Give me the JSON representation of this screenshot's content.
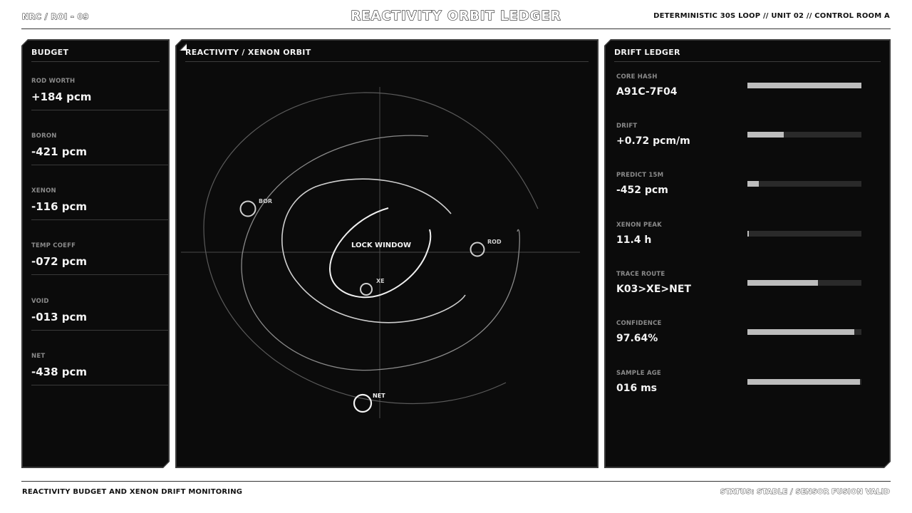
{
  "header": {
    "left": "NRC / ROI - 09",
    "title": "REACTIVITY ORBIT LEDGER",
    "right": "DETERMINISTIC 30S LOOP  //  UNIT 02  //  CONTROL ROOM A"
  },
  "footer": {
    "left": "REACTIVITY BUDGET AND XENON DRIFT MONITORING",
    "right": "STATUS: STABLE / SENSOR FUSION VALID"
  },
  "budget": {
    "title": "BUDGET",
    "items": [
      {
        "label": "ROD WORTH",
        "value": "+184 pcm"
      },
      {
        "label": "BORON",
        "value": "-421 pcm"
      },
      {
        "label": "XENON",
        "value": "-116 pcm"
      },
      {
        "label": "TEMP COEFF",
        "value": "-072 pcm"
      },
      {
        "label": "VOID",
        "value": "-013 pcm"
      },
      {
        "label": "NET",
        "value": "-438 pcm"
      }
    ]
  },
  "orbit": {
    "title": "REACTIVITY / XENON ORBIT",
    "lock_label": "LOCK WINDOW",
    "markers": [
      {
        "id": "bor",
        "label": "BOR"
      },
      {
        "id": "rod",
        "label": "ROD"
      },
      {
        "id": "xe",
        "label": "XE"
      },
      {
        "id": "net",
        "label": "NET"
      }
    ]
  },
  "drift": {
    "title": "DRIFT LEDGER",
    "items": [
      {
        "label": "CORE HASH",
        "value": "A91C-7F04",
        "level": 1.0
      },
      {
        "label": "DRIFT",
        "value": "+0.72 pcm/m",
        "level": 0.32
      },
      {
        "label": "PREDICT 15M",
        "value": "-452 pcm",
        "level": 0.1
      },
      {
        "label": "XENON PEAK",
        "value": "11.4 h",
        "level": 0.01
      },
      {
        "label": "TRACE ROUTE",
        "value": "K03>XE>NET",
        "level": 0.62
      },
      {
        "label": "CONFIDENCE",
        "value": "97.64%",
        "level": 0.94
      },
      {
        "label": "SAMPLE AGE",
        "value": "016 ms",
        "level": 0.99
      }
    ]
  }
}
